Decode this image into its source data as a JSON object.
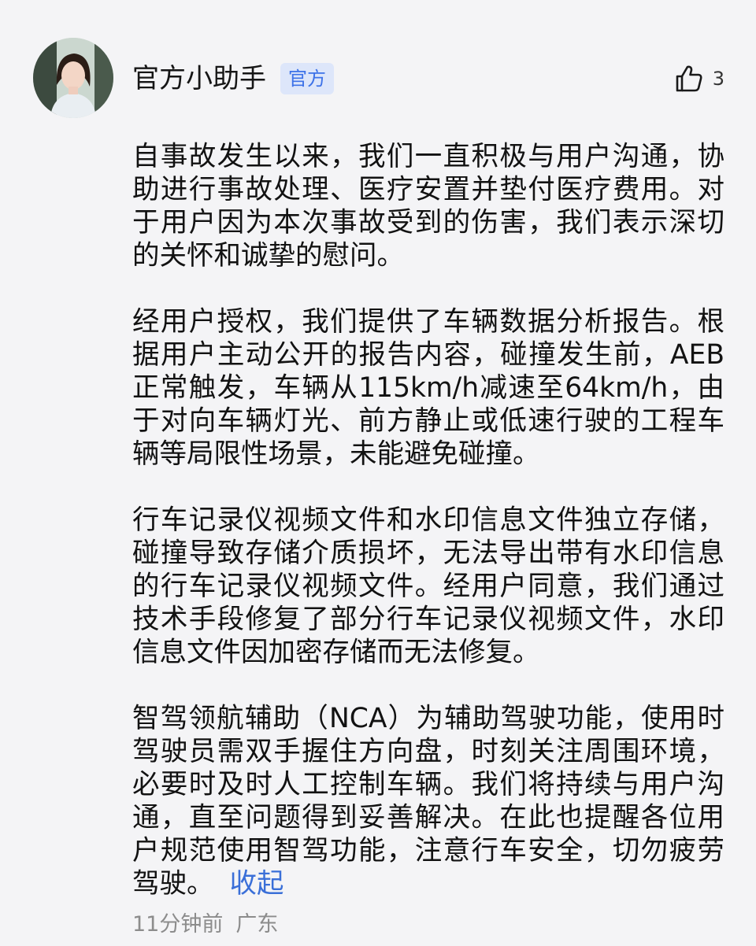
{
  "comment": {
    "author": "官方小助手",
    "badge": "官方",
    "likes": "3",
    "paragraphs": [
      "自事故发生以来，我们一直积极与用户沟通，协助进行事故处理、医疗安置并垫付医疗费用。对于用户因为本次事故受到的伤害，我们表示深切的关怀和诚挚的慰问。",
      "经用户授权，我们提供了车辆数据分析报告。根据用户主动公开的报告内容，碰撞发生前，AEB正常触发，车辆从115km/h减速至64km/h，由于对向车辆灯光、前方静止或低速行驶的工程车辆等局限性场景，未能避免碰撞。",
      "行车记录仪视频文件和水印信息文件独立存储，碰撞导致存储介质损坏，无法导出带有水印信息的行车记录仪视频文件。经用户同意，我们通过技术手段修复了部分行车记录仪视频文件，水印信息文件因加密存储而无法修复。",
      "智驾领航辅助（NCA）为辅助驾驶功能，使用时驾驶员需双手握住方向盘，时刻关注周围环境，必要时及时人工控制车辆。我们将持续与用户沟通，直至问题得到妥善解决。在此也提醒各位用户规范使用智驾功能，注意行车安全，切勿疲劳驾驶。"
    ],
    "collapse_label": "收起",
    "time": "11分钟前",
    "location": "广东"
  },
  "icons": {
    "like": "thumbs-up-icon",
    "avatar": "avatar-photo"
  },
  "colors": {
    "background": "#f4f4f6",
    "badge_bg": "#dde6fa",
    "badge_text": "#3d72e8",
    "link": "#3a6fd8",
    "meta": "#8c8c8c"
  }
}
